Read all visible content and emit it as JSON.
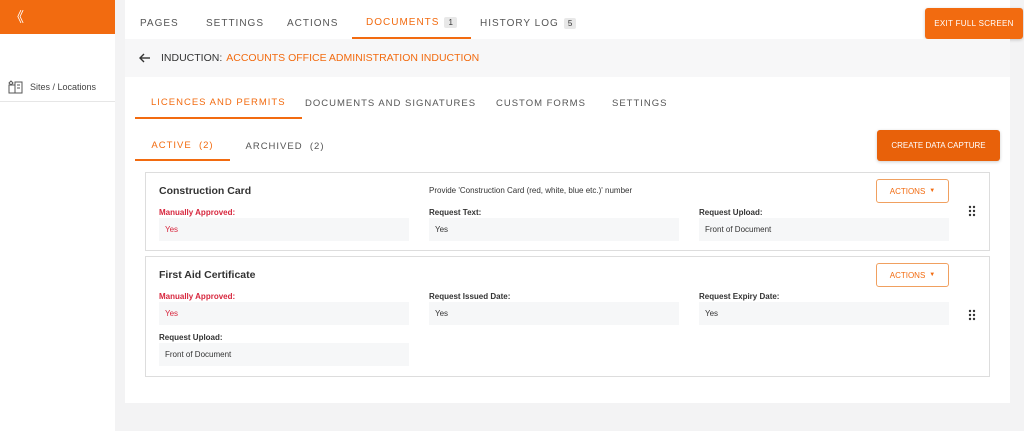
{
  "sidebar": {
    "collapse_glyph": "《",
    "items": [
      {
        "label": "Sites / Locations",
        "icon": "building-icon"
      }
    ]
  },
  "topnav": {
    "tabs": [
      {
        "label": "PAGES"
      },
      {
        "label": "SETTINGS"
      },
      {
        "label": "ACTIONS"
      },
      {
        "label": "DOCUMENTS",
        "badge": "1",
        "active": true
      },
      {
        "label": "HISTORY LOG",
        "badge": "5"
      }
    ],
    "exit_label": "EXIT FULL SCREEN"
  },
  "header": {
    "prefix": "INDUCTION:",
    "name": "ACCOUNTS OFFICE ADMINISTRATION INDUCTION"
  },
  "subtabs": [
    {
      "label": "LICENCES AND PERMITS",
      "active": true
    },
    {
      "label": "DOCUMENTS AND SIGNATURES"
    },
    {
      "label": "CUSTOM FORMS"
    },
    {
      "label": "SETTINGS"
    }
  ],
  "status_tabs": [
    {
      "label": "ACTIVE  (2)",
      "active": true
    },
    {
      "label": "ARCHIVED  (2)"
    }
  ],
  "create_label": "CREATE DATA CAPTURE",
  "cards": [
    {
      "title": "Construction Card",
      "description": "Provide 'Construction Card (red, white, blue etc.)' number",
      "actions_label": "ACTIONS",
      "fields": [
        {
          "label": "Manually Approved:",
          "value": "Yes"
        },
        {
          "label": "Request Text:",
          "value": "Yes"
        },
        {
          "label": "Request Upload:",
          "value": "Front of Document"
        }
      ]
    },
    {
      "title": "First Aid Certificate",
      "actions_label": "ACTIONS",
      "fields": [
        {
          "label": "Manually Approved:",
          "value": "Yes"
        },
        {
          "label": "Request Issued Date:",
          "value": "Yes"
        },
        {
          "label": "Request Expiry Date:",
          "value": "Yes"
        },
        {
          "label": "Request Upload:",
          "value": "Front of Document"
        }
      ]
    }
  ],
  "colors": {
    "accent": "#f26b10",
    "required": "#d7263d",
    "field_bg": "#f6f7f8"
  }
}
